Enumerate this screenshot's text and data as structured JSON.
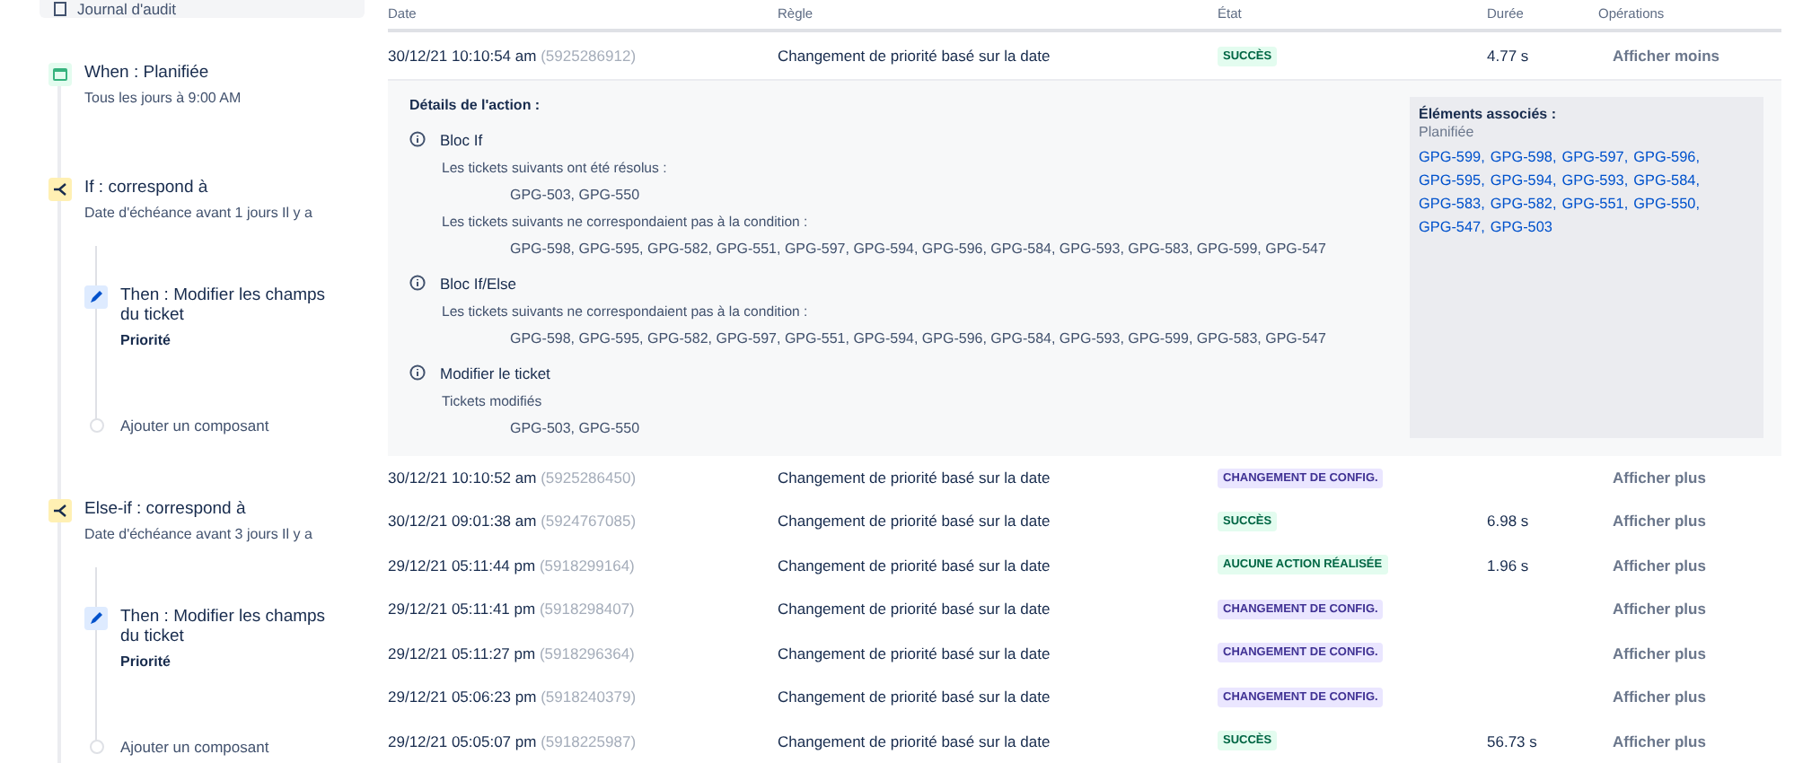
{
  "sidebar": {
    "nav_item": {
      "label": "Journal d'audit"
    },
    "steps": [
      {
        "kind": "trigger",
        "title": "When : Planifiée",
        "subtitle": "Tous les jours à 9:00 AM"
      },
      {
        "kind": "condition",
        "title": "If : correspond à",
        "subtitle": "Date d'échéance avant 1 jours Il y a",
        "children": [
          {
            "kind": "action",
            "title": "Then : Modifier les champs du ticket",
            "detail": "Priorité"
          },
          {
            "kind": "add",
            "title": "Ajouter un composant"
          }
        ]
      },
      {
        "kind": "condition",
        "title": "Else-if : correspond à",
        "subtitle": "Date d'échéance avant 3 jours Il y a",
        "children": [
          {
            "kind": "action",
            "title": "Then : Modifier les champs du ticket",
            "detail": "Priorité"
          },
          {
            "kind": "add",
            "title": "Ajouter un composant"
          }
        ]
      }
    ]
  },
  "table": {
    "columns": [
      "Date",
      "Règle",
      "État",
      "Durée",
      "Opérations"
    ],
    "rows": [
      {
        "date": "30/12/21 10:10:54 am",
        "id": "(5925286912)",
        "rule": "Changement de priorité basé sur la date",
        "status": {
          "kind": "success",
          "label": "SUCCÈS"
        },
        "duration": "4.77 s",
        "operation": "Afficher moins",
        "expanded": true,
        "details": {
          "title": "Détails de l'action :",
          "blocks": [
            {
              "title": "Bloc If",
              "lines": [
                {
                  "kind": "label",
                  "text": "Les tickets suivants ont été résolus :"
                },
                {
                  "kind": "tickets",
                  "text": "GPG-503, GPG-550"
                },
                {
                  "kind": "label",
                  "text": "Les tickets suivants ne correspondaient pas à la condition :"
                },
                {
                  "kind": "tickets",
                  "text": "GPG-598, GPG-595, GPG-582, GPG-551, GPG-597, GPG-594, GPG-596, GPG-584, GPG-593, GPG-583, GPG-599, GPG-547"
                }
              ]
            },
            {
              "title": "Bloc If/Else",
              "lines": [
                {
                  "kind": "label",
                  "text": "Les tickets suivants ne correspondaient pas à la condition :"
                },
                {
                  "kind": "tickets",
                  "text": "GPG-598, GPG-595, GPG-582, GPG-597, GPG-551, GPG-594, GPG-596, GPG-584, GPG-593, GPG-599, GPG-583, GPG-547"
                }
              ]
            },
            {
              "title": "Modifier le ticket",
              "lines": [
                {
                  "kind": "label",
                  "text": "Tickets modifiés"
                },
                {
                  "kind": "tickets",
                  "text": "GPG-503, GPG-550"
                }
              ]
            }
          ],
          "related": {
            "title": "Éléments associés :",
            "subtitle": "Planifiée",
            "links": [
              "GPG-599,",
              "GPG-598,",
              "GPG-597,",
              "GPG-596,",
              "GPG-595,",
              "GPG-594,",
              "GPG-593,",
              "GPG-584,",
              "GPG-583,",
              "GPG-582,",
              "GPG-551,",
              "GPG-550,",
              "GPG-547,",
              "GPG-503"
            ]
          }
        }
      },
      {
        "date": "30/12/21 10:10:52 am",
        "id": "(5925286450)",
        "rule": "Changement de priorité basé sur la date",
        "status": {
          "kind": "config",
          "label": "CHANGEMENT DE CONFIG."
        },
        "duration": "",
        "operation": "Afficher plus",
        "expanded": false
      },
      {
        "date": "30/12/21 09:01:38 am",
        "id": "(5924767085)",
        "rule": "Changement de priorité basé sur la date",
        "status": {
          "kind": "success",
          "label": "SUCCÈS"
        },
        "duration": "6.98 s",
        "operation": "Afficher plus",
        "expanded": false
      },
      {
        "date": "29/12/21 05:11:44 pm",
        "id": "(5918299164)",
        "rule": "Changement de priorité basé sur la date",
        "status": {
          "kind": "no_action",
          "label": "AUCUNE ACTION RÉALISÉE"
        },
        "duration": "1.96 s",
        "operation": "Afficher plus",
        "expanded": false
      },
      {
        "date": "29/12/21 05:11:41 pm",
        "id": "(5918298407)",
        "rule": "Changement de priorité basé sur la date",
        "status": {
          "kind": "config",
          "label": "CHANGEMENT DE CONFIG."
        },
        "duration": "",
        "operation": "Afficher plus",
        "expanded": false
      },
      {
        "date": "29/12/21 05:11:27 pm",
        "id": "(5918296364)",
        "rule": "Changement de priorité basé sur la date",
        "status": {
          "kind": "config",
          "label": "CHANGEMENT DE CONFIG."
        },
        "duration": "",
        "operation": "Afficher plus",
        "expanded": false
      },
      {
        "date": "29/12/21 05:06:23 pm",
        "id": "(5918240379)",
        "rule": "Changement de priorité basé sur la date",
        "status": {
          "kind": "config",
          "label": "CHANGEMENT DE CONFIG."
        },
        "duration": "",
        "operation": "Afficher plus",
        "expanded": false
      },
      {
        "date": "29/12/21 05:05:07 pm",
        "id": "(5918225987)",
        "rule": "Changement de priorité basé sur la date",
        "status": {
          "kind": "success",
          "label": "SUCCÈS"
        },
        "duration": "56.73 s",
        "operation": "Afficher plus",
        "expanded": false
      }
    ]
  }
}
